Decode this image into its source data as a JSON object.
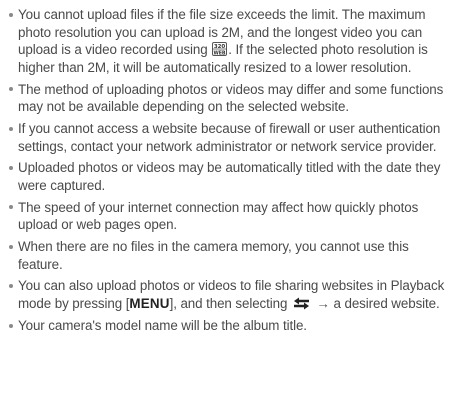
{
  "notes": [
    {
      "a": "You cannot upload files if the file size exceeds the limit. The maximum photo resolution you can upload is 2M, and the longest video you can upload is a video recorded using ",
      "icon_label": "320 WEB",
      "b": ". If the selected photo resolution is higher than 2M, it will be automatically resized to a lower resolution."
    },
    {
      "text": "The method of uploading photos or videos may differ and some functions may not be available depending on the selected website."
    },
    {
      "text": "If you cannot access a website because of firewall or user authentication settings, contact your network administrator or network service provider."
    },
    {
      "text": "Uploaded photos or videos may be automatically titled with the date they were captured."
    },
    {
      "text": "The speed of your internet connection may affect how quickly photos upload or web pages open."
    },
    {
      "text": "When there are no files in the camera memory, you cannot use this feature."
    },
    {
      "a": "You can also upload photos or videos to file sharing websites in Playback mode by pressing [",
      "key": "MENU",
      "b": "], and then selecting ",
      "c": " → a desired website."
    },
    {
      "text": "Your camera's model name will be the album title."
    }
  ],
  "icons": {
    "resolution_icon": "320-web-icon",
    "share_icon": "share-arrows-icon"
  },
  "colors": {
    "text": "#4a4a4a",
    "bullet": "#8a8a8a",
    "key": "#222222"
  }
}
